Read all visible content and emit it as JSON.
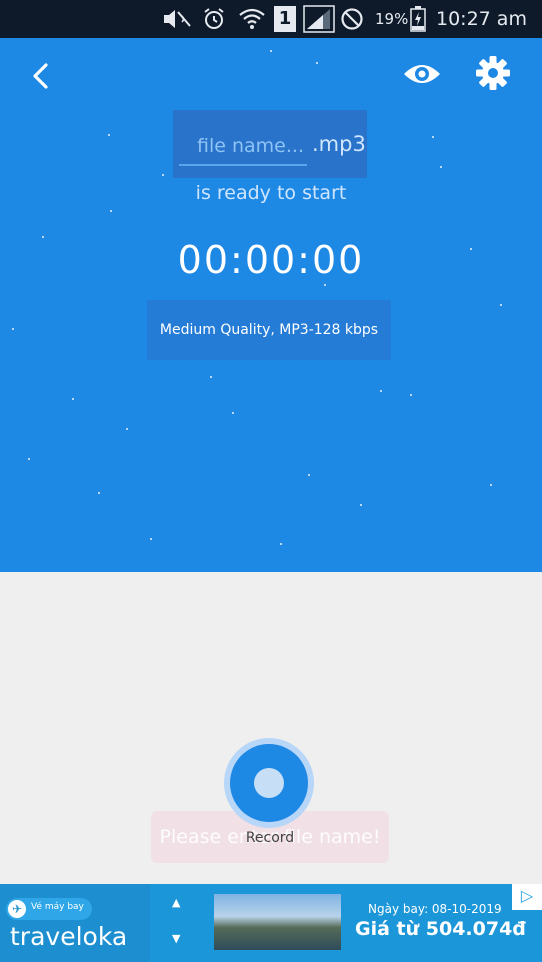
{
  "status_bar": {
    "battery": "19%",
    "time": "10:27 am",
    "sim": "1"
  },
  "recorder": {
    "filename_placeholder": "file name...",
    "extension": ".mp3",
    "ready_text": "is ready to start",
    "timer": "00:00:00",
    "quality": "Medium Quality, MP3-128 kbps"
  },
  "record": {
    "label": "Record"
  },
  "toast": {
    "text": "Please enter file name!"
  },
  "ad": {
    "tag": "Vé máy bay",
    "brand": "traveloka",
    "date_label": "Ngày bay: 08-10-2019",
    "price": "Giá từ 504.074đ"
  },
  "icons": {
    "back": "back-arrow-icon",
    "eye": "eye-icon",
    "gear": "gear-icon"
  },
  "colors": {
    "panel": "#1e88e5",
    "status_bar": "#0e1a2a",
    "background": "#efefef",
    "ad": "#1b96d8"
  }
}
